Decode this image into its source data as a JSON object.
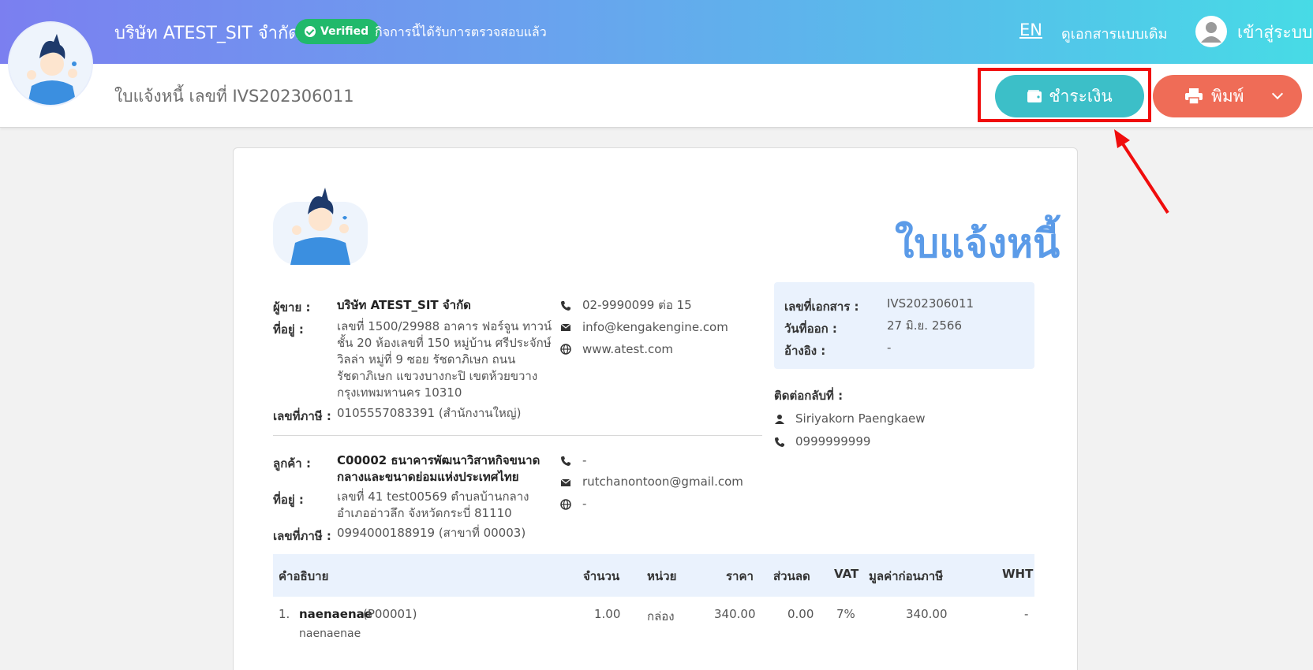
{
  "header": {
    "company_name": "บริษัท ATEST_SIT จำกัด",
    "verified_badge": "Verified",
    "verified_text": "กิจการนี้ได้รับการตรวจสอบแล้ว",
    "language": "EN",
    "old_doc_link": "ดูเอกสารแบบเดิม",
    "login": "เข้าสู่ระบบ"
  },
  "subheader": {
    "doc_title": "ใบแจ้งหนี้ เลขที่ IVS202306011",
    "pay_button": "ชำระเงิน",
    "print_button": "พิมพ์"
  },
  "document": {
    "title": "ใบแจ้งหนี้",
    "seller": {
      "label_seller": "ผู้ขาย :",
      "name": "บริษัท ATEST_SIT จำกัด",
      "label_address": "ที่อยู่ :",
      "address_lines": [
        "เลขที่ 1500/29988 อาคาร ฟอร์จูน ทาวน์",
        "ชั้น 20 ห้องเลขที่ 150 หมู่บ้าน ศรีประจักษ์",
        "วิลล่า หมู่ที่ 9 ซอย รัชดาภิเษก ถนน",
        "รัชดาภิเษก แขวงบางกะปิ เขตห้วยขวาง",
        "กรุงเทพมหานคร 10310"
      ],
      "label_tax": "เลขที่ภาษี :",
      "tax_id": "0105557083391 (สำนักงานใหญ่)",
      "phone": "02-9990099 ต่อ 15",
      "email": "info@kengakengine.com",
      "website": "www.atest.com"
    },
    "customer": {
      "label_customer": "ลูกค้า :",
      "name_lines": [
        "C00002 ธนาคารพัฒนาวิสาหกิจขนาด",
        "กลางและขนาดย่อมแห่งประเทศไทย"
      ],
      "label_address": "ที่อยู่ :",
      "address_lines": [
        "เลขที่ 41  test00569  ตำบลบ้านกลาง",
        "อำเภออ่าวลึก จังหวัดกระบี่ 81110"
      ],
      "label_tax": "เลขที่ภาษี :",
      "tax_id": "0994000188919 (สาขาที่ 00003)",
      "phone": "-",
      "email": "rutchanontoon@gmail.com",
      "website": "-"
    },
    "info": {
      "label_doc_no": "เลขที่เอกสาร :",
      "doc_no": "IVS202306011",
      "label_date": "วันที่ออก :",
      "date": "27 มิ.ย. 2566",
      "label_ref": "อ้างอิง :",
      "ref": "-"
    },
    "contact": {
      "label": "ติดต่อกลับที่ :",
      "name": "Siriyakorn Paengkaew",
      "phone": "0999999999"
    },
    "table": {
      "headers": [
        "คำอธิบาย",
        "จำนวน",
        "หน่วย",
        "ราคา",
        "ส่วนลด",
        "VAT",
        "มูลค่าก่อนภาษี",
        "WHT"
      ],
      "rows": [
        {
          "no": "1.",
          "name": "naenaenae",
          "code": "(P00001)",
          "desc": "naenaenae",
          "qty": "1.00",
          "unit": "กล่อง",
          "price": "340.00",
          "discount": "0.00",
          "vat": "7%",
          "pretax": "340.00",
          "wht": "-"
        }
      ]
    }
  },
  "colors": {
    "gradient_start": "#7b7ff0",
    "gradient_end": "#47dbe6",
    "pay_button": "#3cbfc8",
    "print_button": "#ef6c57",
    "title_blue": "#5b9be8",
    "verified_green": "#21b96b",
    "highlight_red": "#f00d0d"
  },
  "icons": [
    "wallet-icon",
    "printer-icon",
    "chevron-down-icon",
    "phone-icon",
    "envelope-icon",
    "globe-icon",
    "user-icon"
  ]
}
